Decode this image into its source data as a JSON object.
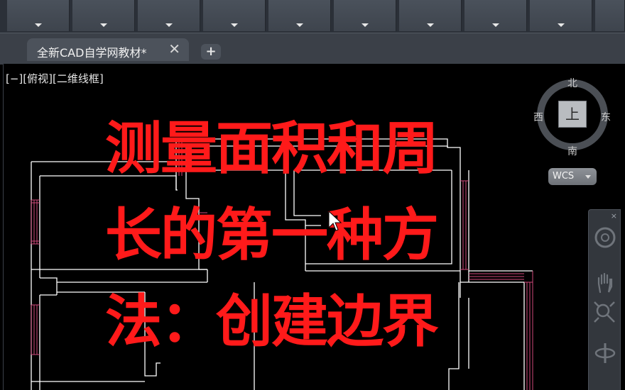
{
  "document_tab": {
    "title": "全新CAD自学网教材*",
    "close_glyph": "✕",
    "add_glyph": "+"
  },
  "viewport": {
    "label": "[−][俯视][二维线框]"
  },
  "viewcube": {
    "north": "北",
    "south": "南",
    "east": "东",
    "west": "西",
    "face": "上"
  },
  "wcs": {
    "label": "WCS"
  },
  "navbar": {
    "close_glyph": "×",
    "icons": [
      "steering-wheel-icon",
      "pan-hand-icon",
      "zoom-extents-icon",
      "orbit-icon"
    ]
  },
  "caption": {
    "line1": "测量面积和周",
    "line2": "长的第一种方",
    "line3": "法：创建边界"
  },
  "colors": {
    "caption": "#ff1a1a",
    "plan_lines": "#ffffff",
    "window_lines": "#d1497a",
    "ribbon": "#4a515b"
  }
}
